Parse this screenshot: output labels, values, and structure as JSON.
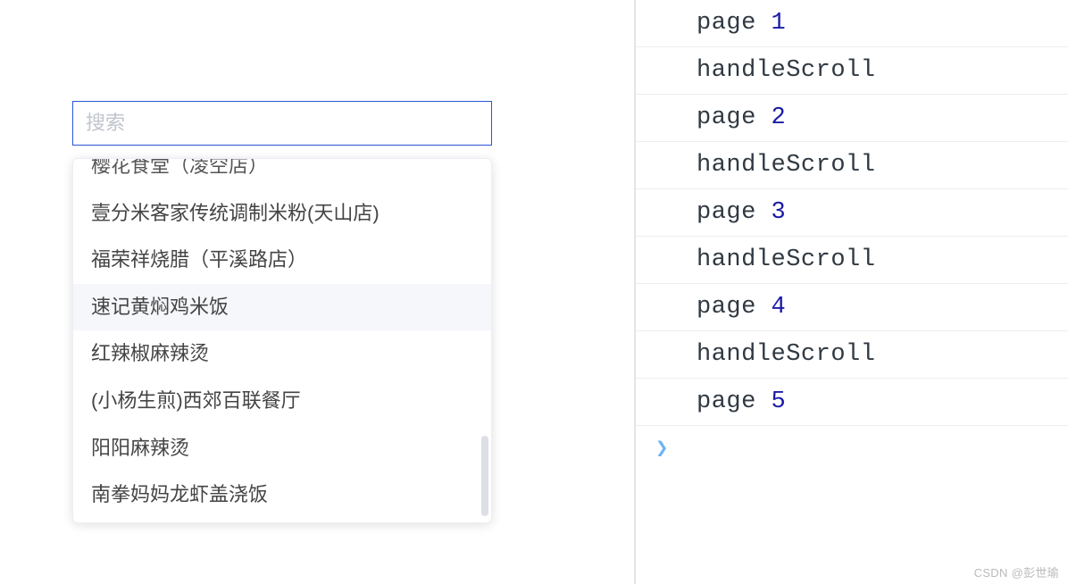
{
  "search": {
    "placeholder": "搜索",
    "value": ""
  },
  "dropdown": {
    "items": [
      {
        "label": "樱花食堂（凌空店）",
        "partial": true
      },
      {
        "label": "壹分米客家传统调制米粉(天山店)"
      },
      {
        "label": "福荣祥烧腊（平溪路店）"
      },
      {
        "label": "速记黄焖鸡米饭",
        "hovered": true
      },
      {
        "label": "红辣椒麻辣烫"
      },
      {
        "label": "(小杨生煎)西郊百联餐厅"
      },
      {
        "label": "阳阳麻辣烫"
      },
      {
        "label": "南拳妈妈龙虾盖浇饭"
      }
    ]
  },
  "console": {
    "lines": [
      {
        "prefix": "page ",
        "value": "1"
      },
      {
        "text": "handleScroll"
      },
      {
        "prefix": "page ",
        "value": "2"
      },
      {
        "text": "handleScroll"
      },
      {
        "prefix": "page ",
        "value": "3"
      },
      {
        "text": "handleScroll"
      },
      {
        "prefix": "page ",
        "value": "4"
      },
      {
        "text": "handleScroll"
      },
      {
        "prefix": "page ",
        "value": "5"
      }
    ],
    "prompt": "❯"
  },
  "watermark": "CSDN @彭世瑜"
}
